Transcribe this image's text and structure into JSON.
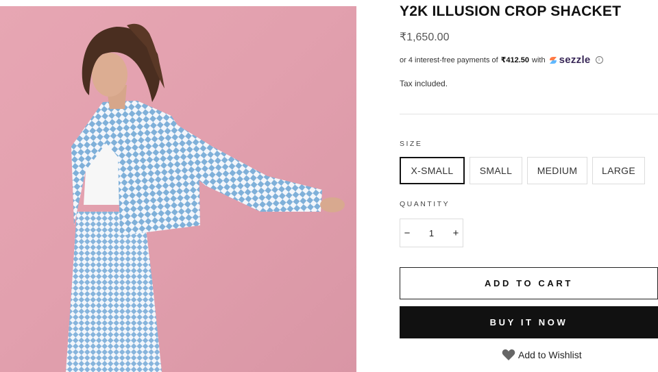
{
  "product": {
    "title": "Y2K ILLUSION CROP SHACKET",
    "price": "₹1,650.00",
    "installments": {
      "prefix": "or 4 interest-free payments of",
      "amount": "₹412.50",
      "suffix": "with",
      "brand": "sezzle"
    },
    "tax_note": "Tax included."
  },
  "size": {
    "label": "SIZE",
    "options": [
      "X-SMALL",
      "SMALL",
      "MEDIUM",
      "LARGE"
    ],
    "selected": "X-SMALL"
  },
  "quantity": {
    "label": "QUANTITY",
    "value": "1",
    "minus": "−",
    "plus": "+"
  },
  "actions": {
    "add_to_cart": "ADD TO CART",
    "buy_now": "BUY IT NOW",
    "wishlist": "Add to Wishlist"
  },
  "colors": {
    "photo_background": "#e2a0ae",
    "checker_blue": "#7fb0d9",
    "buy_button": "#111111",
    "sezzle_brand": "#382757"
  }
}
